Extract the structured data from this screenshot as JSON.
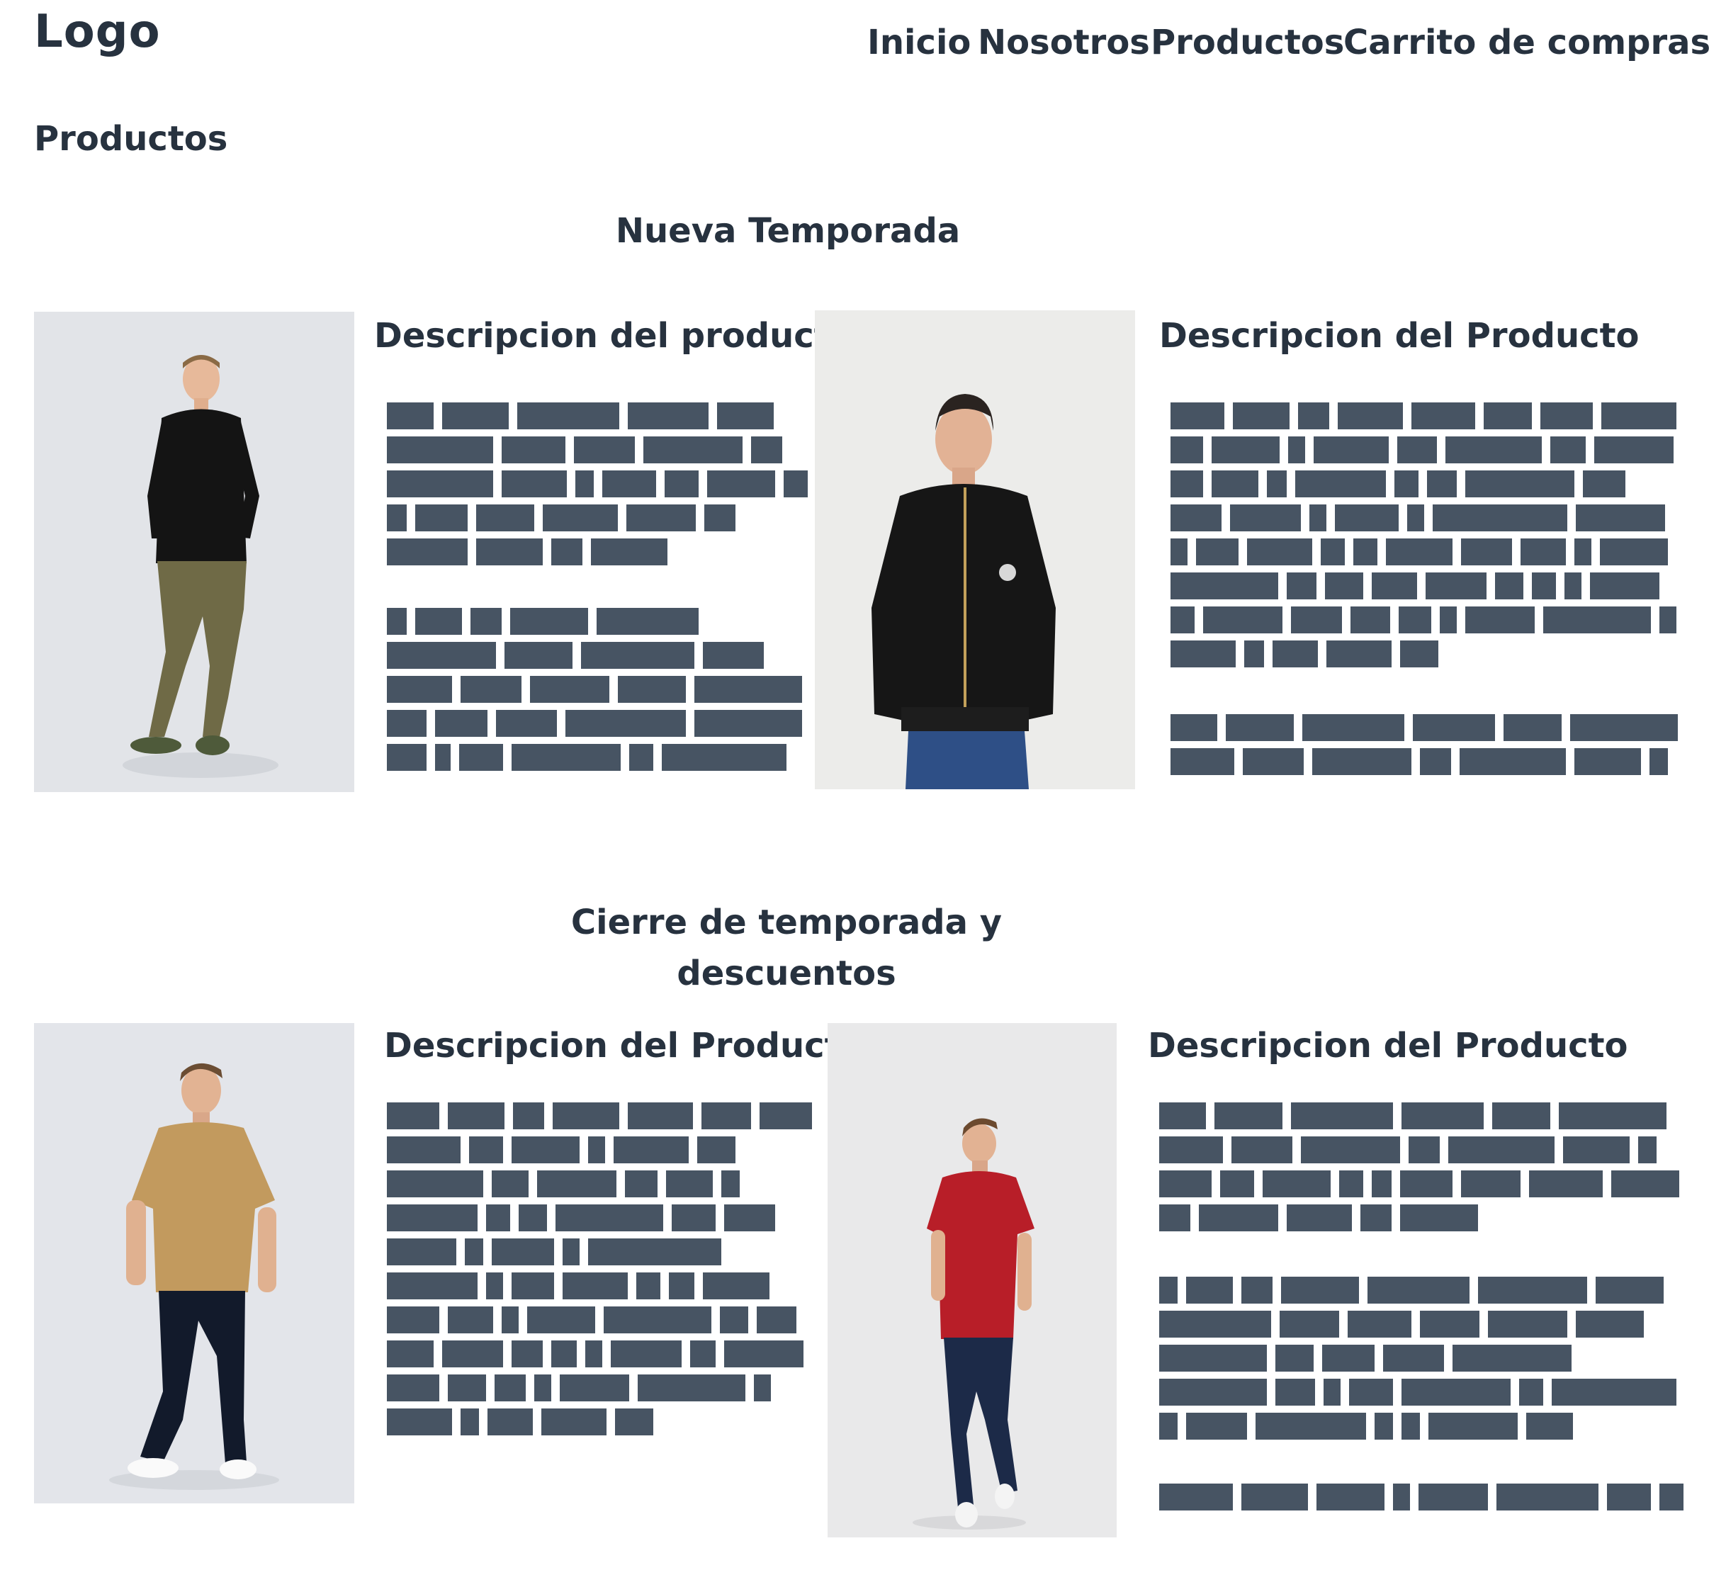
{
  "header": {
    "logo": "Logo",
    "nav": [
      "Inicio",
      "Nosotros",
      "Productos",
      "Carrito de compras"
    ]
  },
  "page_title": "Productos",
  "sections": [
    {
      "title": "Nueva Temporada",
      "products": [
        {
          "description_title": "Descripcion del producto"
        },
        {
          "description_title": "Descripcion del Producto"
        }
      ]
    },
    {
      "title": "Cierre de  temporada y descuentos",
      "products": [
        {
          "description_title": "Descripcion del Producto"
        },
        {
          "description_title": "Descripcion del Producto"
        }
      ]
    }
  ],
  "colors": {
    "text": "#27323f",
    "placeholder_text": "#475463",
    "background": "#ffffff"
  }
}
